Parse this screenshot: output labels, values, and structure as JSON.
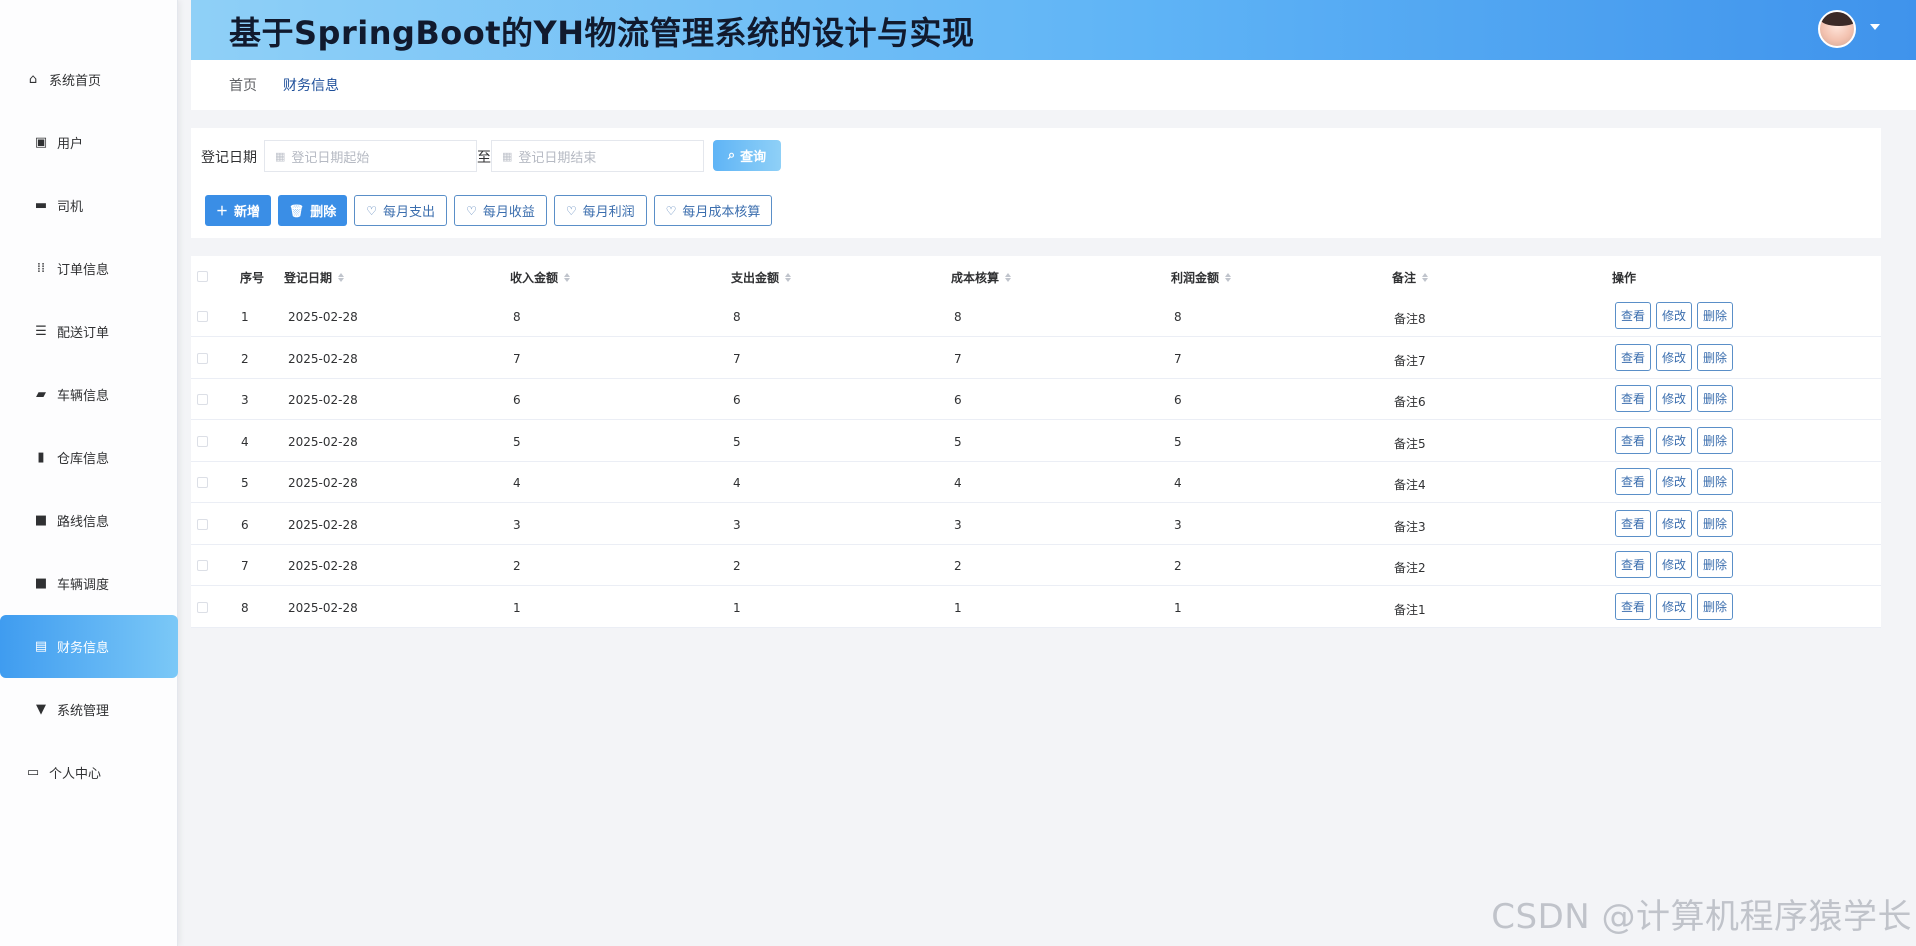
{
  "sidebar": {
    "items": [
      {
        "label": "系统首页",
        "icon": "home-icon",
        "glyph": "⌂"
      },
      {
        "label": "用户",
        "icon": "clipboard-icon",
        "glyph": "▣"
      },
      {
        "label": "司机",
        "icon": "monitor-icon",
        "glyph": "▬"
      },
      {
        "label": "订单信息",
        "icon": "grid-icon",
        "glyph": "⁞⁞"
      },
      {
        "label": "配送订单",
        "icon": "sliders-icon",
        "glyph": "☰"
      },
      {
        "label": "车辆信息",
        "icon": "vehicle-icon",
        "glyph": "▰"
      },
      {
        "label": "仓库信息",
        "icon": "bar-chart-icon",
        "glyph": "▮"
      },
      {
        "label": "路线信息",
        "icon": "apps-icon",
        "glyph": "■"
      },
      {
        "label": "车辆调度",
        "icon": "apps-icon",
        "glyph": "■"
      },
      {
        "label": "财务信息",
        "icon": "briefcase-icon",
        "glyph": "▤"
      },
      {
        "label": "系统管理",
        "icon": "pin-icon",
        "glyph": "▼"
      },
      {
        "label": "个人中心",
        "icon": "wallet-icon",
        "glyph": "▭"
      }
    ],
    "active_index": 9,
    "active_color": "#3f9cf0"
  },
  "header": {
    "title": "基于SpringBoot的YH物流管理系统的设计与实现",
    "gradient_start": "#8fd0f7",
    "gradient_end": "#3f93ec"
  },
  "breadcrumb": {
    "home": "首页",
    "current": "财务信息"
  },
  "search": {
    "label": "登记日期",
    "start_placeholder": "登记日期起始",
    "to_label": "至",
    "end_placeholder": "登记日期结束",
    "query_label": "查询"
  },
  "actions": {
    "add": "新增",
    "delete": "删除",
    "monthly_expense": "每月支出",
    "monthly_income": "每月收益",
    "monthly_profit": "每月利润",
    "monthly_cost": "每月成本核算"
  },
  "table": {
    "headers": {
      "index": "序号",
      "date": "登记日期",
      "income": "收入金额",
      "expense": "支出金额",
      "cost": "成本核算",
      "profit": "利润金额",
      "remark": "备注",
      "ops": "操作"
    },
    "rows": [
      {
        "index": "1",
        "date": "2025-02-28",
        "income": "8",
        "expense": "8",
        "cost": "8",
        "profit": "8",
        "remark": "备注8"
      },
      {
        "index": "2",
        "date": "2025-02-28",
        "income": "7",
        "expense": "7",
        "cost": "7",
        "profit": "7",
        "remark": "备注7"
      },
      {
        "index": "3",
        "date": "2025-02-28",
        "income": "6",
        "expense": "6",
        "cost": "6",
        "profit": "6",
        "remark": "备注6"
      },
      {
        "index": "4",
        "date": "2025-02-28",
        "income": "5",
        "expense": "5",
        "cost": "5",
        "profit": "5",
        "remark": "备注5"
      },
      {
        "index": "5",
        "date": "2025-02-28",
        "income": "4",
        "expense": "4",
        "cost": "4",
        "profit": "4",
        "remark": "备注4"
      },
      {
        "index": "6",
        "date": "2025-02-28",
        "income": "3",
        "expense": "3",
        "cost": "3",
        "profit": "3",
        "remark": "备注3"
      },
      {
        "index": "7",
        "date": "2025-02-28",
        "income": "2",
        "expense": "2",
        "cost": "2",
        "profit": "2",
        "remark": "备注2"
      },
      {
        "index": "8",
        "date": "2025-02-28",
        "income": "1",
        "expense": "1",
        "cost": "1",
        "profit": "1",
        "remark": "备注1"
      }
    ],
    "row_ops": {
      "view": "查看",
      "edit": "修改",
      "delete": "删除"
    }
  },
  "watermark": "CSDN @计算机程序猿学长"
}
